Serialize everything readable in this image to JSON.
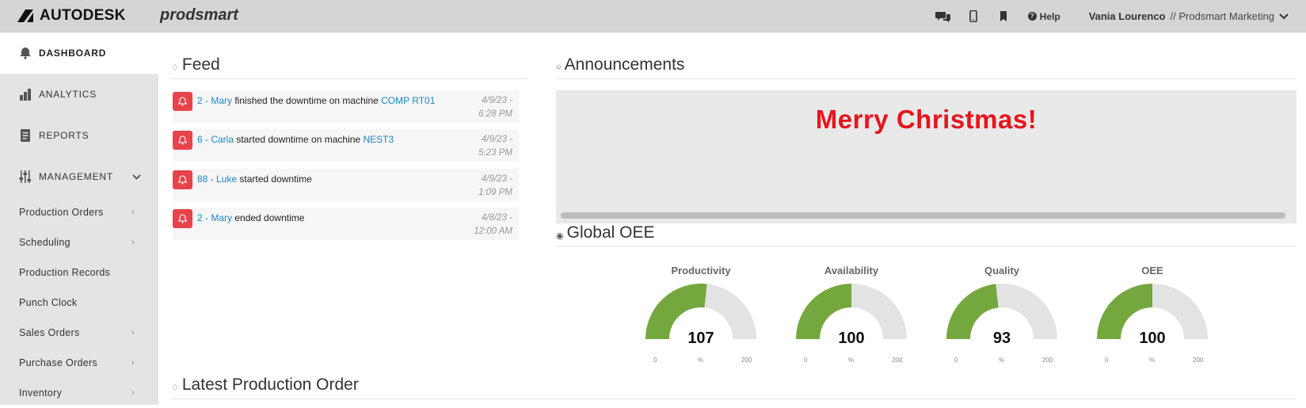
{
  "topbar": {
    "brand": "AUTODESK",
    "product": "prodsmart",
    "icons": [
      "chat-icon",
      "mobile-icon",
      "bookmark-icon"
    ],
    "help_label": "Help",
    "user_name": "Vania Lourenco",
    "user_org": "// Prodsmart Marketing"
  },
  "sidebar": {
    "main": [
      {
        "label": "DASHBOARD",
        "icon": "bell-icon"
      },
      {
        "label": "ANALYTICS",
        "icon": "bar-chart-icon"
      },
      {
        "label": "REPORTS",
        "icon": "document-icon"
      },
      {
        "label": "MANAGEMENT",
        "icon": "sliders-icon"
      }
    ],
    "sub": [
      {
        "label": "Production Orders",
        "arrow": true
      },
      {
        "label": "Scheduling",
        "arrow": true
      },
      {
        "label": "Production Records",
        "arrow": false
      },
      {
        "label": "Punch Clock",
        "arrow": false
      },
      {
        "label": "Sales Orders",
        "arrow": true
      },
      {
        "label": "Purchase Orders",
        "arrow": true
      },
      {
        "label": "Inventory",
        "arrow": true
      }
    ]
  },
  "feed": {
    "title": "Feed",
    "items": [
      {
        "user": "2 - Mary",
        "text": " finished the downtime on machine ",
        "machine": "COMP RT01",
        "date": "4/9/23 -",
        "time": "6:28 PM"
      },
      {
        "user": "6 - Carla",
        "text": " started downtime on machine ",
        "machine": "NEST3",
        "date": "4/9/23 -",
        "time": "5:23 PM"
      },
      {
        "user": "88 - Luke",
        "text": " started downtime",
        "machine": "",
        "date": "4/9/23 -",
        "time": "1:09 PM"
      },
      {
        "user": "2 - Mary",
        "text": " ended downtime",
        "machine": "",
        "date": "4/8/23 -",
        "time": "12:00 AM"
      }
    ]
  },
  "announcements": {
    "title": "Announcements",
    "message": "Merry Christmas!",
    "message_color": "#e8141c"
  },
  "oee": {
    "title": "Global OEE",
    "gauges": [
      {
        "label": "Productivity",
        "value": 107,
        "min": "0",
        "max": "200",
        "unit": "%"
      },
      {
        "label": "Availability",
        "value": 100,
        "min": "0",
        "max": "200",
        "unit": "%"
      },
      {
        "label": "Quality",
        "value": 93,
        "min": "0",
        "max": "200",
        "unit": "%"
      },
      {
        "label": "OEE",
        "value": 100,
        "min": "0",
        "max": "200",
        "unit": "%"
      }
    ],
    "fill_color": "#74a83e",
    "track_color": "#e3e3e3"
  },
  "latest": {
    "title": "Latest Production Order"
  }
}
